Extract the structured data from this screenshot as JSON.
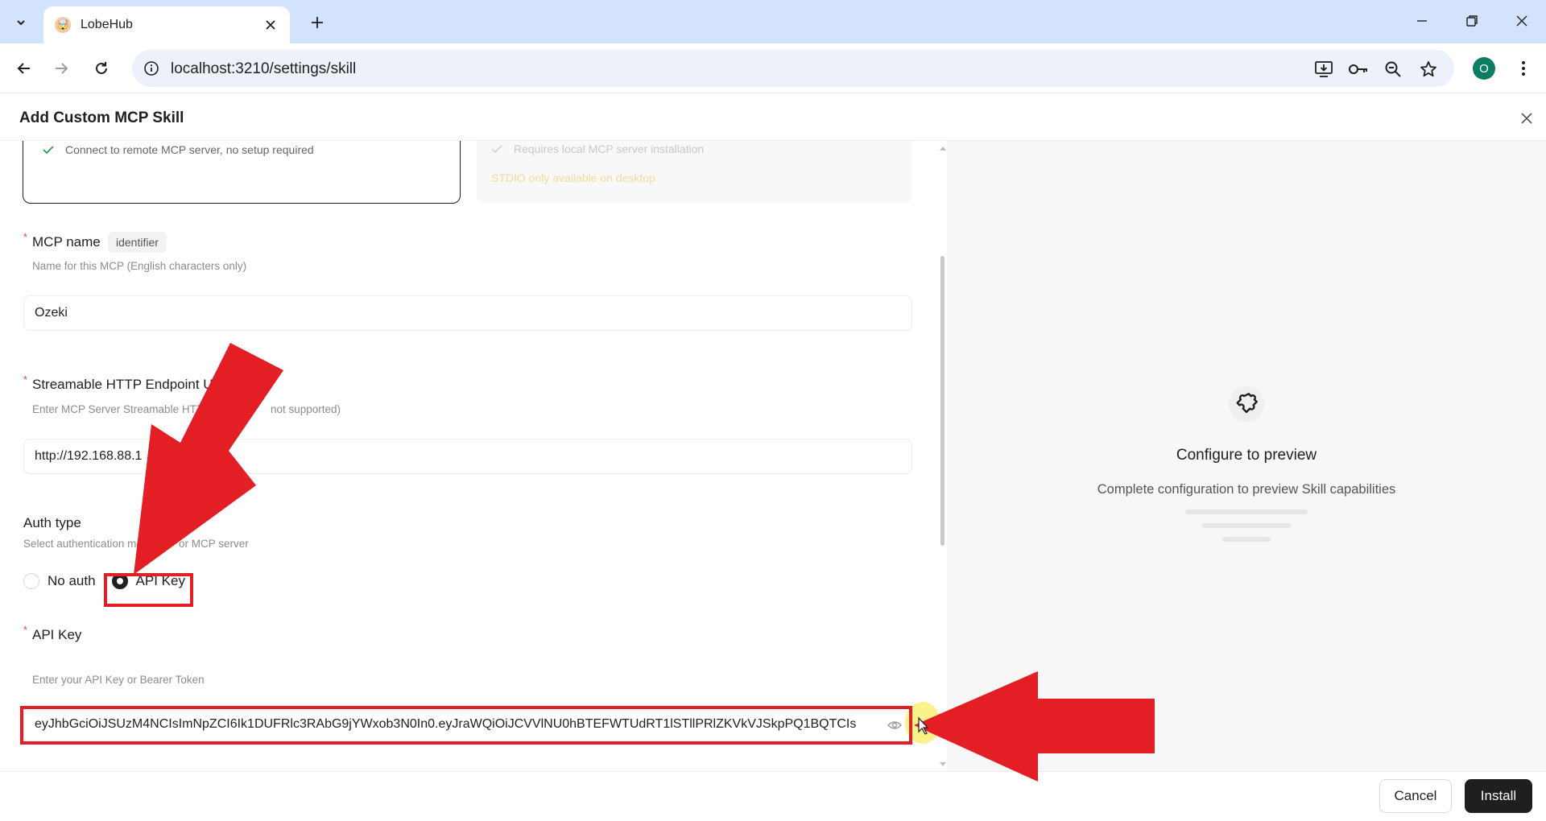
{
  "browser": {
    "tab_title": "LobeHub",
    "url": "localhost:3210/settings/skill",
    "profile_initial": "O",
    "icons": {
      "tab_search": "chevron-down-icon",
      "favicon": "lobehub-favicon",
      "tab_close": "close-icon",
      "new_tab": "plus-icon",
      "minimize": "minimize-icon",
      "restore": "restore-icon",
      "close_window": "close-icon",
      "back": "arrow-left-icon",
      "forward": "arrow-right-icon",
      "reload": "reload-icon",
      "site_info": "info-icon",
      "install_app": "install-icon",
      "passwords": "key-icon",
      "zoom": "zoom-icon",
      "bookmark": "star-icon",
      "menu": "more-vert-icon"
    }
  },
  "modal": {
    "title": "Add Custom MCP Skill",
    "cards": {
      "remote_feature": "Connect to remote MCP server, no setup required",
      "local_feature": "Requires local MCP server installation",
      "local_warning": "STDIO only available on desktop"
    },
    "mcp_name": {
      "required_mark": "*",
      "label": "MCP name",
      "tag": "identifier",
      "description": "Name for this MCP (English characters only)",
      "value": "Ozeki"
    },
    "endpoint": {
      "required_mark": "*",
      "label_visible": "Streamable HTTP Endpoint U",
      "description_part1": "Enter MCP Server Streamable HTT",
      "description_part2": "not supported)",
      "value_visible": "http://192.168.88.1"
    },
    "auth": {
      "label": "Auth type",
      "description_part1": "Select authentication meth",
      "description_part2": "or MCP server",
      "options": [
        "No auth",
        "API Key"
      ],
      "selected": "API Key"
    },
    "api_key": {
      "required_mark": "*",
      "label": "API Key",
      "description": "Enter your API Key or Bearer Token",
      "value": "eyJhbGciOiJSUzM4NCIsImNpZCI6Ik1DUFRlc3RAbG9jYWxob3N0In0.eyJraWQiOiJCVVlNU0hBTEFWTUdRT1lSTllPRlZKVkVJSkpPQ1BQTCIs"
    },
    "preview": {
      "icon": "puzzle-icon",
      "title": "Configure to preview",
      "subtitle": "Complete configuration to preview Skill capabilities"
    },
    "footer": {
      "cancel": "Cancel",
      "install": "Install"
    }
  },
  "colors": {
    "annotation_red": "#e31e24",
    "tabstrip": "#d3e3fd",
    "primary_button": "#1f1f1f",
    "profile_badge": "#0b7d63"
  }
}
